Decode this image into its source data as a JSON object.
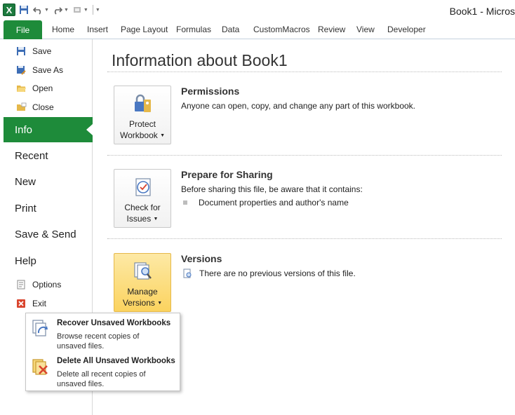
{
  "window": {
    "title": "Book1 - Micros"
  },
  "qat": {
    "logo": "X",
    "icons": [
      "save-icon",
      "undo-icon",
      "redo-icon",
      "customize-icon"
    ]
  },
  "ribbon": {
    "file_tab": "File",
    "tabs": [
      "Home",
      "Insert",
      "Page Layout",
      "Formulas",
      "Data",
      "CustomMacros",
      "Review",
      "View",
      "Developer"
    ]
  },
  "nav": {
    "save": "Save",
    "save_as": "Save As",
    "open": "Open",
    "close": "Close",
    "info": "Info",
    "recent": "Recent",
    "new": "New",
    "print": "Print",
    "save_send": "Save & Send",
    "help": "Help",
    "options": "Options",
    "exit": "Exit"
  },
  "main": {
    "title": "Information about Book1",
    "permissions": {
      "button_line1": "Protect",
      "button_line2": "Workbook",
      "title": "Permissions",
      "text": "Anyone can open, copy, and change any part of this workbook."
    },
    "sharing": {
      "button_line1": "Check for",
      "button_line2": "Issues",
      "title": "Prepare for Sharing",
      "text": "Before sharing this file, be aware that it contains:",
      "bullet": "Document properties and author's name"
    },
    "versions": {
      "button_line1": "Manage",
      "button_line2": "Versions",
      "title": "Versions",
      "text": "There are no previous versions of this file."
    }
  },
  "menu": {
    "recover": {
      "title": "Recover Unsaved Workbooks",
      "desc": "Browse recent copies of unsaved files."
    },
    "delete": {
      "title": "Delete All Unsaved Workbooks",
      "desc": "Delete all recent copies of unsaved files."
    }
  },
  "colors": {
    "accent": "#1e8b3a",
    "highlight": "#fbd35f"
  }
}
